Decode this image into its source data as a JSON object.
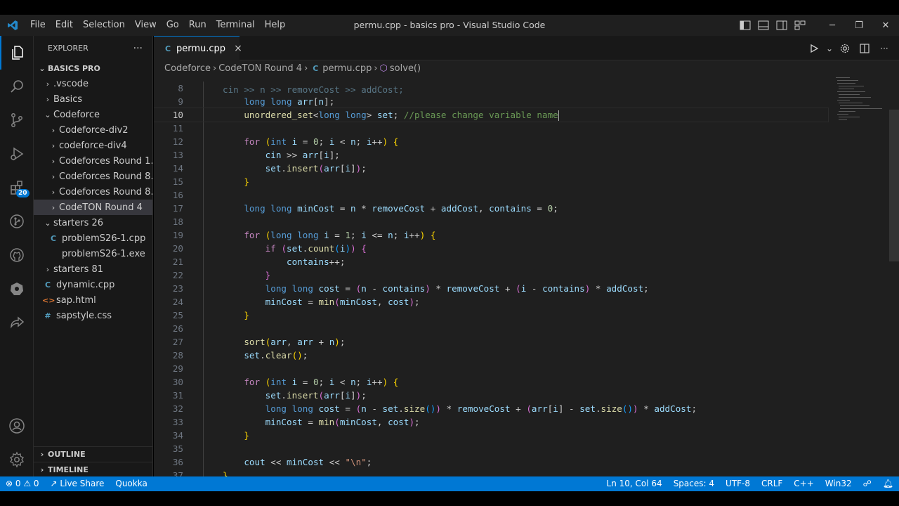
{
  "window": {
    "title": "permu.cpp - basics pro - Visual Studio Code",
    "menu": [
      "File",
      "Edit",
      "Selection",
      "View",
      "Go",
      "Run",
      "Terminal",
      "Help"
    ]
  },
  "activity_bar": {
    "items": [
      "explorer-icon",
      "search-icon",
      "source-control-icon",
      "run-debug-icon",
      "extensions-icon",
      "git-graph-icon",
      "github-icon",
      "kubernetes-icon",
      "live-share-icon"
    ],
    "extensions_badge": "20",
    "bottom": [
      "account-icon",
      "settings-gear-icon"
    ]
  },
  "sidebar": {
    "header": "EXPLORER",
    "more": "···",
    "root": "BASICS PRO",
    "tree": [
      {
        "label": ".vscode",
        "type": "folder-closed",
        "depth": 1
      },
      {
        "label": "Basics",
        "type": "folder-closed",
        "depth": 1
      },
      {
        "label": "Codeforce",
        "type": "folder-open",
        "depth": 1
      },
      {
        "label": "Codeforce-div2",
        "type": "folder-closed",
        "depth": 2
      },
      {
        "label": "codeforce-div4",
        "type": "folder-closed",
        "depth": 2
      },
      {
        "label": "Codeforces Round 1...",
        "type": "folder-closed",
        "depth": 2
      },
      {
        "label": "Codeforces Round 8...",
        "type": "folder-closed",
        "depth": 2
      },
      {
        "label": "Codeforces Round 8...",
        "type": "folder-closed",
        "depth": 2
      },
      {
        "label": "CodeTON Round 4",
        "type": "folder-closed",
        "depth": 2,
        "selected": true
      },
      {
        "label": "starters 26",
        "type": "folder-open",
        "depth": 1
      },
      {
        "label": "problemS26-1.cpp",
        "type": "cpp",
        "depth": 2
      },
      {
        "label": "problemS26-1.exe",
        "type": "exe",
        "depth": 2
      },
      {
        "label": "starters 81",
        "type": "folder-closed",
        "depth": 1
      },
      {
        "label": "dynamic.cpp",
        "type": "cpp",
        "depth": 1
      },
      {
        "label": "sap.html",
        "type": "html",
        "depth": 1
      },
      {
        "label": "sapstyle.css",
        "type": "css",
        "depth": 1
      }
    ],
    "outline": "OUTLINE",
    "timeline": "TIMELINE"
  },
  "tab": {
    "label": "permu.cpp",
    "close": "×"
  },
  "breadcrumb": [
    "Codeforce",
    "CodeTON Round 4",
    "permu.cpp",
    "solve()"
  ],
  "editor": {
    "cursor_line": 10,
    "partial_top_line": "cin >> n >> removeCost >> addCost;",
    "lines": [
      {
        "n": "8",
        "tokens": []
      },
      {
        "n": "9",
        "tokens": [
          [
            "    ",
            "p"
          ],
          [
            "long long ",
            "k"
          ],
          [
            "arr",
            "v"
          ],
          [
            "[",
            "p"
          ],
          [
            "n",
            "v"
          ],
          [
            "];",
            "p"
          ]
        ]
      },
      {
        "n": "10",
        "tokens": [
          [
            "    ",
            "p"
          ],
          [
            "unordered_set",
            "f"
          ],
          [
            "<",
            "p"
          ],
          [
            "long long",
            "k"
          ],
          [
            "> ",
            "p"
          ],
          [
            "set",
            "v"
          ],
          [
            "; ",
            "p"
          ],
          [
            "//please change variable name",
            "c"
          ]
        ]
      },
      {
        "n": "11",
        "tokens": []
      },
      {
        "n": "12",
        "tokens": [
          [
            "    ",
            "p"
          ],
          [
            "for",
            "k2"
          ],
          [
            " ",
            "p"
          ],
          [
            "(",
            "b"
          ],
          [
            "int ",
            "k"
          ],
          [
            "i",
            "v"
          ],
          [
            " = ",
            "p"
          ],
          [
            "0",
            "num"
          ],
          [
            "; ",
            "p"
          ],
          [
            "i",
            "v"
          ],
          [
            " < ",
            "p"
          ],
          [
            "n",
            "v"
          ],
          [
            "; ",
            "p"
          ],
          [
            "i",
            "v"
          ],
          [
            "++",
            "p"
          ],
          [
            ")",
            "b"
          ],
          [
            " ",
            "p"
          ],
          [
            "{",
            "b"
          ]
        ]
      },
      {
        "n": "13",
        "tokens": [
          [
            "        ",
            "p"
          ],
          [
            "cin",
            "v"
          ],
          [
            " >> ",
            "p"
          ],
          [
            "arr",
            "v"
          ],
          [
            "[",
            "p"
          ],
          [
            "i",
            "v"
          ],
          [
            "];",
            "p"
          ]
        ]
      },
      {
        "n": "14",
        "tokens": [
          [
            "        ",
            "p"
          ],
          [
            "set",
            "v"
          ],
          [
            ".",
            "p"
          ],
          [
            "insert",
            "f"
          ],
          [
            "(",
            "b2"
          ],
          [
            "arr",
            "v"
          ],
          [
            "[",
            "p"
          ],
          [
            "i",
            "v"
          ],
          [
            "]",
            "p"
          ],
          [
            ")",
            "b2"
          ],
          [
            ";",
            "p"
          ]
        ]
      },
      {
        "n": "15",
        "tokens": [
          [
            "    ",
            "p"
          ],
          [
            "}",
            "b"
          ]
        ]
      },
      {
        "n": "16",
        "tokens": []
      },
      {
        "n": "17",
        "tokens": [
          [
            "    ",
            "p"
          ],
          [
            "long long ",
            "k"
          ],
          [
            "minCost",
            "v"
          ],
          [
            " = ",
            "p"
          ],
          [
            "n",
            "v"
          ],
          [
            " * ",
            "p"
          ],
          [
            "removeCost",
            "v"
          ],
          [
            " + ",
            "p"
          ],
          [
            "addCost",
            "v"
          ],
          [
            ", ",
            "p"
          ],
          [
            "contains",
            "v"
          ],
          [
            " = ",
            "p"
          ],
          [
            "0",
            "num"
          ],
          [
            ";",
            "p"
          ]
        ]
      },
      {
        "n": "18",
        "tokens": []
      },
      {
        "n": "19",
        "tokens": [
          [
            "    ",
            "p"
          ],
          [
            "for",
            "k2"
          ],
          [
            " ",
            "p"
          ],
          [
            "(",
            "b"
          ],
          [
            "long long ",
            "k"
          ],
          [
            "i",
            "v"
          ],
          [
            " = ",
            "p"
          ],
          [
            "1",
            "num"
          ],
          [
            "; ",
            "p"
          ],
          [
            "i",
            "v"
          ],
          [
            " <= ",
            "p"
          ],
          [
            "n",
            "v"
          ],
          [
            "; ",
            "p"
          ],
          [
            "i",
            "v"
          ],
          [
            "++",
            "p"
          ],
          [
            ")",
            "b"
          ],
          [
            " ",
            "p"
          ],
          [
            "{",
            "b"
          ]
        ]
      },
      {
        "n": "20",
        "tokens": [
          [
            "        ",
            "p"
          ],
          [
            "if",
            "k2"
          ],
          [
            " ",
            "p"
          ],
          [
            "(",
            "b2"
          ],
          [
            "set",
            "v"
          ],
          [
            ".",
            "p"
          ],
          [
            "count",
            "f"
          ],
          [
            "(",
            "b3"
          ],
          [
            "i",
            "v"
          ],
          [
            ")",
            "b3"
          ],
          [
            ")",
            "b2"
          ],
          [
            " ",
            "p"
          ],
          [
            "{",
            "b2"
          ]
        ]
      },
      {
        "n": "21",
        "tokens": [
          [
            "            ",
            "p"
          ],
          [
            "contains",
            "v"
          ],
          [
            "++;",
            "p"
          ]
        ]
      },
      {
        "n": "22",
        "tokens": [
          [
            "        ",
            "p"
          ],
          [
            "}",
            "b2"
          ]
        ]
      },
      {
        "n": "23",
        "tokens": [
          [
            "        ",
            "p"
          ],
          [
            "long long ",
            "k"
          ],
          [
            "cost",
            "v"
          ],
          [
            " = ",
            "p"
          ],
          [
            "(",
            "b2"
          ],
          [
            "n",
            "v"
          ],
          [
            " - ",
            "p"
          ],
          [
            "contains",
            "v"
          ],
          [
            ")",
            "b2"
          ],
          [
            " * ",
            "p"
          ],
          [
            "removeCost",
            "v"
          ],
          [
            " + ",
            "p"
          ],
          [
            "(",
            "b2"
          ],
          [
            "i",
            "v"
          ],
          [
            " - ",
            "p"
          ],
          [
            "contains",
            "v"
          ],
          [
            ")",
            "b2"
          ],
          [
            " * ",
            "p"
          ],
          [
            "addCost",
            "v"
          ],
          [
            ";",
            "p"
          ]
        ]
      },
      {
        "n": "24",
        "tokens": [
          [
            "        ",
            "p"
          ],
          [
            "minCost",
            "v"
          ],
          [
            " = ",
            "p"
          ],
          [
            "min",
            "f"
          ],
          [
            "(",
            "b2"
          ],
          [
            "minCost",
            "v"
          ],
          [
            ", ",
            "p"
          ],
          [
            "cost",
            "v"
          ],
          [
            ")",
            "b2"
          ],
          [
            ";",
            "p"
          ]
        ]
      },
      {
        "n": "25",
        "tokens": [
          [
            "    ",
            "p"
          ],
          [
            "}",
            "b"
          ]
        ]
      },
      {
        "n": "26",
        "tokens": []
      },
      {
        "n": "27",
        "tokens": [
          [
            "    ",
            "p"
          ],
          [
            "sort",
            "f"
          ],
          [
            "(",
            "b"
          ],
          [
            "arr",
            "v"
          ],
          [
            ", ",
            "p"
          ],
          [
            "arr",
            "v"
          ],
          [
            " + ",
            "p"
          ],
          [
            "n",
            "v"
          ],
          [
            ")",
            "b"
          ],
          [
            ";",
            "p"
          ]
        ]
      },
      {
        "n": "28",
        "tokens": [
          [
            "    ",
            "p"
          ],
          [
            "set",
            "v"
          ],
          [
            ".",
            "p"
          ],
          [
            "clear",
            "f"
          ],
          [
            "()",
            "b"
          ],
          [
            ";",
            "p"
          ]
        ]
      },
      {
        "n": "29",
        "tokens": []
      },
      {
        "n": "30",
        "tokens": [
          [
            "    ",
            "p"
          ],
          [
            "for",
            "k2"
          ],
          [
            " ",
            "p"
          ],
          [
            "(",
            "b"
          ],
          [
            "int ",
            "k"
          ],
          [
            "i",
            "v"
          ],
          [
            " = ",
            "p"
          ],
          [
            "0",
            "num"
          ],
          [
            "; ",
            "p"
          ],
          [
            "i",
            "v"
          ],
          [
            " < ",
            "p"
          ],
          [
            "n",
            "v"
          ],
          [
            "; ",
            "p"
          ],
          [
            "i",
            "v"
          ],
          [
            "++",
            "p"
          ],
          [
            ")",
            "b"
          ],
          [
            " ",
            "p"
          ],
          [
            "{",
            "b"
          ]
        ]
      },
      {
        "n": "31",
        "tokens": [
          [
            "        ",
            "p"
          ],
          [
            "set",
            "v"
          ],
          [
            ".",
            "p"
          ],
          [
            "insert",
            "f"
          ],
          [
            "(",
            "b2"
          ],
          [
            "arr",
            "v"
          ],
          [
            "[",
            "p"
          ],
          [
            "i",
            "v"
          ],
          [
            "]",
            "p"
          ],
          [
            ")",
            "b2"
          ],
          [
            ";",
            "p"
          ]
        ]
      },
      {
        "n": "32",
        "tokens": [
          [
            "        ",
            "p"
          ],
          [
            "long long ",
            "k"
          ],
          [
            "cost",
            "v"
          ],
          [
            " = ",
            "p"
          ],
          [
            "(",
            "b2"
          ],
          [
            "n",
            "v"
          ],
          [
            " - ",
            "p"
          ],
          [
            "set",
            "v"
          ],
          [
            ".",
            "p"
          ],
          [
            "size",
            "f"
          ],
          [
            "()",
            "b3"
          ],
          [
            ")",
            "b2"
          ],
          [
            " * ",
            "p"
          ],
          [
            "removeCost",
            "v"
          ],
          [
            " + ",
            "p"
          ],
          [
            "(",
            "b2"
          ],
          [
            "arr",
            "v"
          ],
          [
            "[",
            "p"
          ],
          [
            "i",
            "v"
          ],
          [
            "]",
            "p"
          ],
          [
            " - ",
            "p"
          ],
          [
            "set",
            "v"
          ],
          [
            ".",
            "p"
          ],
          [
            "size",
            "f"
          ],
          [
            "()",
            "b3"
          ],
          [
            ")",
            "b2"
          ],
          [
            " * ",
            "p"
          ],
          [
            "addCost",
            "v"
          ],
          [
            ";",
            "p"
          ]
        ]
      },
      {
        "n": "33",
        "tokens": [
          [
            "        ",
            "p"
          ],
          [
            "minCost",
            "v"
          ],
          [
            " = ",
            "p"
          ],
          [
            "min",
            "f"
          ],
          [
            "(",
            "b2"
          ],
          [
            "minCost",
            "v"
          ],
          [
            ", ",
            "p"
          ],
          [
            "cost",
            "v"
          ],
          [
            ")",
            "b2"
          ],
          [
            ";",
            "p"
          ]
        ]
      },
      {
        "n": "34",
        "tokens": [
          [
            "    ",
            "p"
          ],
          [
            "}",
            "b"
          ]
        ]
      },
      {
        "n": "35",
        "tokens": []
      },
      {
        "n": "36",
        "tokens": [
          [
            "    ",
            "p"
          ],
          [
            "cout",
            "v"
          ],
          [
            " << ",
            "p"
          ],
          [
            "minCost",
            "v"
          ],
          [
            " << ",
            "p"
          ],
          [
            "\"\\n\"",
            "s"
          ],
          [
            ";",
            "p"
          ]
        ]
      },
      {
        "n": "37",
        "tokens": [
          [
            "}",
            "b"
          ]
        ]
      }
    ]
  },
  "statusbar": {
    "problems": "⊗ 0 ⚠ 0",
    "live_share": "Live Share",
    "quokka": "Quokka",
    "position": "Ln 10, Col 64",
    "spaces": "Spaces: 4",
    "encoding": "UTF-8",
    "eol": "CRLF",
    "language": "C++",
    "platform": "Win32"
  },
  "colors": {
    "keyword": "#569cd6",
    "control": "#c586c0",
    "variable": "#9cdcfe",
    "function": "#dcdcaa",
    "number": "#b5cea8",
    "string": "#ce9178",
    "comment": "#6a9955",
    "bracket1": "#ffd700",
    "bracket2": "#da70d6",
    "bracket3": "#179fff",
    "accent": "#0078d4"
  }
}
